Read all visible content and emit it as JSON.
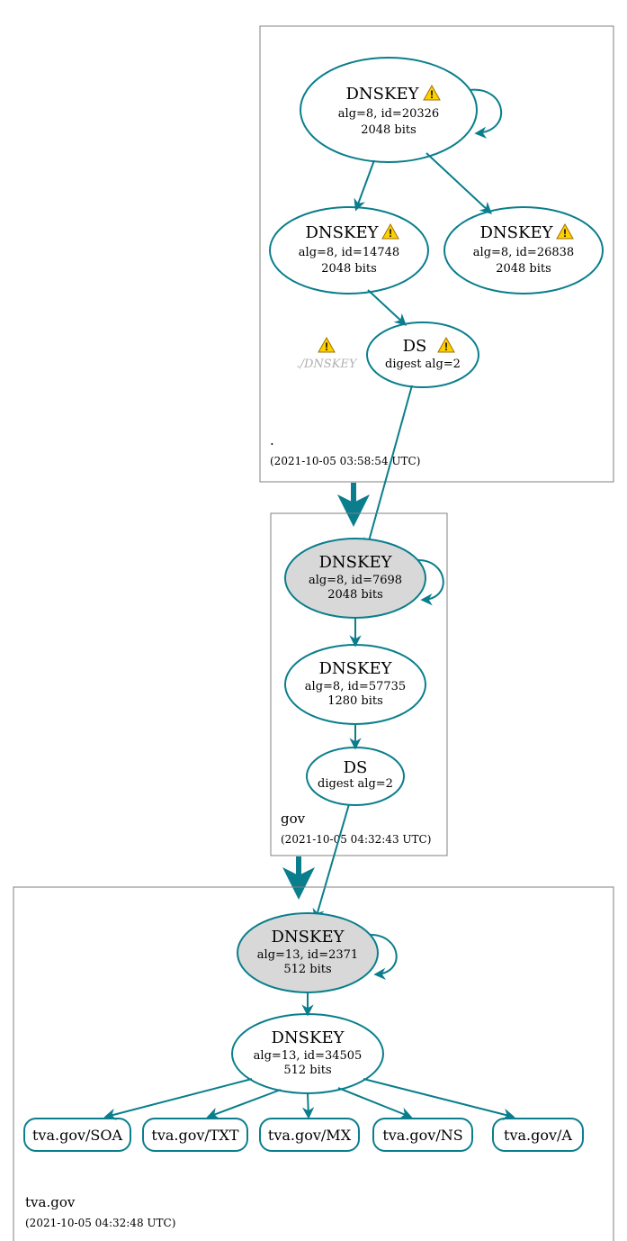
{
  "zones": {
    "root": {
      "label": ".",
      "timestamp": "(2021-10-05 03:58:54 UTC)",
      "nodes": {
        "ksk": {
          "title": "DNSKEY",
          "line1": "alg=8, id=20326",
          "line2": "2048 bits",
          "warn": true
        },
        "zsk_a": {
          "title": "DNSKEY",
          "line1": "alg=8, id=14748",
          "line2": "2048 bits",
          "warn": true
        },
        "zsk_b": {
          "title": "DNSKEY",
          "line1": "alg=8, id=26838",
          "line2": "2048 bits",
          "warn": true
        },
        "ds": {
          "title": "DS",
          "line1": "digest alg=2",
          "warn": true
        },
        "ghost": {
          "title": "./DNSKEY",
          "warn": true
        }
      }
    },
    "gov": {
      "label": "gov",
      "timestamp": "(2021-10-05 04:32:43 UTC)",
      "nodes": {
        "ksk": {
          "title": "DNSKEY",
          "line1": "alg=8, id=7698",
          "line2": "2048 bits"
        },
        "zsk": {
          "title": "DNSKEY",
          "line1": "alg=8, id=57735",
          "line2": "1280 bits"
        },
        "ds": {
          "title": "DS",
          "line1": "digest alg=2"
        }
      }
    },
    "tva": {
      "label": "tva.gov",
      "timestamp": "(2021-10-05 04:32:48 UTC)",
      "nodes": {
        "ksk": {
          "title": "DNSKEY",
          "line1": "alg=13, id=2371",
          "line2": "512 bits"
        },
        "zsk": {
          "title": "DNSKEY",
          "line1": "alg=13, id=34505",
          "line2": "512 bits"
        }
      },
      "rr": {
        "soa": "tva.gov/SOA",
        "txt": "tva.gov/TXT",
        "mx": "tva.gov/MX",
        "ns": "tva.gov/NS",
        "a": "tva.gov/A"
      }
    }
  }
}
